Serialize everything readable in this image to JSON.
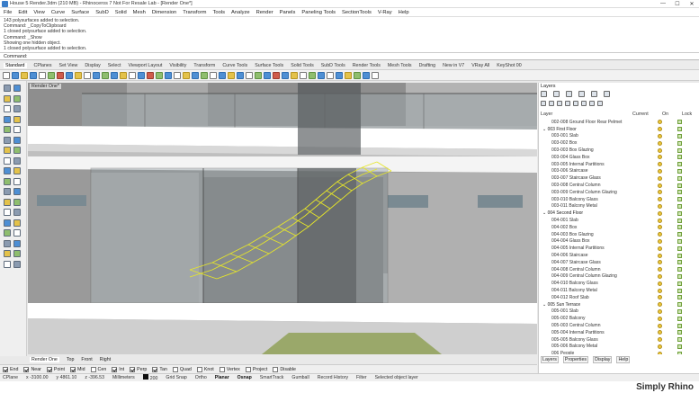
{
  "window": {
    "title": "House 5 Render.3dm (210 MB) - Rhinoceros 7 Not For Resale Lab - [Render One*]",
    "controls": [
      "—",
      "☐",
      "✕"
    ]
  },
  "menu": [
    "File",
    "Edit",
    "View",
    "Curve",
    "Surface",
    "SubD",
    "Solid",
    "Mesh",
    "Dimension",
    "Transform",
    "Tools",
    "Analyze",
    "Render",
    "Panels",
    "Paneling Tools",
    "SectionTools",
    "V-Ray",
    "Help"
  ],
  "history": [
    "143 polysurfaces added to selection.",
    "Command: _CopyToClipboard",
    "1 closed polysurface added to selection.",
    "Command: _Show",
    "Showing one hidden object.",
    "1 closed polysurface added to selection."
  ],
  "command": {
    "label": "Command:",
    "value": ""
  },
  "tabs": [
    "Standard",
    "CPlanes",
    "Set View",
    "Display",
    "Select",
    "Viewport Layout",
    "Visibility",
    "Transform",
    "Curve Tools",
    "Surface Tools",
    "Solid Tools",
    "SubD Tools",
    "Render Tools",
    "Mesh Tools",
    "Drafting",
    "New in V7",
    "VRay All",
    "KeyShot 00"
  ],
  "viewport": {
    "label": "Render One*"
  },
  "view_tabs": [
    "Render One",
    "Top",
    "Front",
    "Right"
  ],
  "osnaps": [
    {
      "label": "End",
      "on": true
    },
    {
      "label": "Near",
      "on": true
    },
    {
      "label": "Point",
      "on": true
    },
    {
      "label": "Mid",
      "on": true
    },
    {
      "label": "Cen",
      "on": false
    },
    {
      "label": "Int",
      "on": true
    },
    {
      "label": "Perp",
      "on": true
    },
    {
      "label": "Tan",
      "on": true
    },
    {
      "label": "Quad",
      "on": false
    },
    {
      "label": "Knot",
      "on": false
    },
    {
      "label": "Vertex",
      "on": false
    },
    {
      "label": "Project",
      "on": false
    },
    {
      "label": "Disable",
      "on": false
    }
  ],
  "status": {
    "cplane": "CPlane",
    "x": "x -3100.00",
    "y": "y 4861.10",
    "z": "z -396.53",
    "units": "Millimeters",
    "layer": "200",
    "grid_snap": "Grid Snap",
    "ortho": "Ortho",
    "planar": "Planar",
    "osnap": "Osnap",
    "smarttrack": "SmartTrack",
    "gumball": "Gumball",
    "record_history": "Record History",
    "filter": "Filter",
    "message": "Selected object layer"
  },
  "panel": {
    "title": "Layers",
    "columns": {
      "layer": "Layer",
      "current": "Current",
      "on": "On",
      "lock": "Lock"
    },
    "layers": [
      {
        "name": "002-008 Ground Floor Rear Pelmet",
        "group": false
      },
      {
        "name": "003 First Floor",
        "group": true
      },
      {
        "name": "003-001 Slab",
        "group": false
      },
      {
        "name": "003-002 Box",
        "group": false
      },
      {
        "name": "003-003 Box Glazing",
        "group": false
      },
      {
        "name": "003-004 Glass Box",
        "group": false
      },
      {
        "name": "003-005 Internal Partitions",
        "group": false
      },
      {
        "name": "003-006 Staircase",
        "group": false
      },
      {
        "name": "003-007 Staircase Glass",
        "group": false
      },
      {
        "name": "003-008 Central Column",
        "group": false
      },
      {
        "name": "003-009 Central Column Glazing",
        "group": false
      },
      {
        "name": "003-010 Balcony Glass",
        "group": false
      },
      {
        "name": "003-011 Balcony Metal",
        "group": false
      },
      {
        "name": "004 Second Floor",
        "group": true
      },
      {
        "name": "004-001 Slab",
        "group": false
      },
      {
        "name": "004-002 Box",
        "group": false
      },
      {
        "name": "004-003 Box Glazing",
        "group": false
      },
      {
        "name": "004-004 Glass Box",
        "group": false
      },
      {
        "name": "004-005 Internal Partitions",
        "group": false
      },
      {
        "name": "004-006 Staircase",
        "group": false
      },
      {
        "name": "004-007 Staircase Glass",
        "group": false
      },
      {
        "name": "004-008 Central Column",
        "group": false
      },
      {
        "name": "004-009 Central Column Glazing",
        "group": false
      },
      {
        "name": "004-010 Balcony Glass",
        "group": false
      },
      {
        "name": "004-011 Balcony Metal",
        "group": false
      },
      {
        "name": "004-012 Roof Slab",
        "group": false
      },
      {
        "name": "005 Sun Terrace",
        "group": true
      },
      {
        "name": "005-001 Slab",
        "group": false
      },
      {
        "name": "005-002 Balcony",
        "group": false
      },
      {
        "name": "005-003 Central Column",
        "group": false
      },
      {
        "name": "005-004 Internal Partitions",
        "group": false
      },
      {
        "name": "005-005 Balcony Glass",
        "group": false
      },
      {
        "name": "005-006 Balcony Metal",
        "group": false
      },
      {
        "name": "006 People",
        "group": false
      }
    ],
    "tabs": [
      "Layers",
      "Properties",
      "Display",
      "Help"
    ]
  },
  "watermark": "Simply Rhino"
}
